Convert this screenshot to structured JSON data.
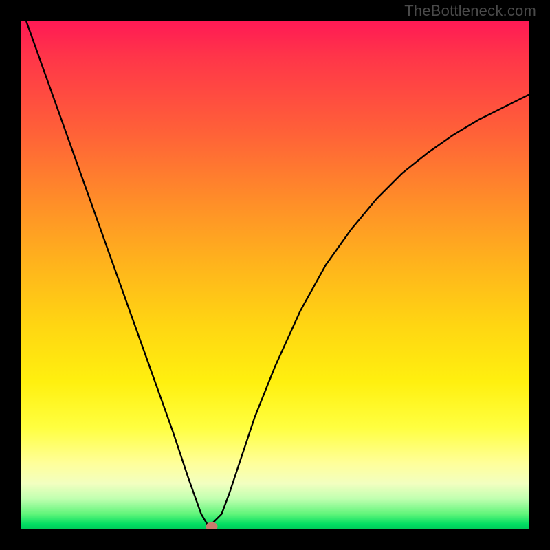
{
  "watermark": "TheBottleneck.com",
  "chart_data": {
    "type": "line",
    "title": "",
    "xlabel": "",
    "ylabel": "",
    "xlim": [
      0,
      1
    ],
    "ylim": [
      0,
      1
    ],
    "legend": false,
    "grid": false,
    "background_gradient": {
      "top_color": "#ff1955",
      "bottom_color": "#00c859",
      "description": "vertical gradient red→orange→yellow→green representing bottleneck severity (high at top, low at bottom)"
    },
    "marker": {
      "x": 0.375,
      "y": 0.005,
      "color": "#c97a6d"
    },
    "series": [
      {
        "name": "bottleneck-curve-left",
        "x": [
          0.0,
          0.05,
          0.1,
          0.15,
          0.2,
          0.25,
          0.3,
          0.33,
          0.355,
          0.37
        ],
        "values": [
          1.03,
          0.89,
          0.75,
          0.61,
          0.47,
          0.33,
          0.19,
          0.1,
          0.03,
          0.005
        ]
      },
      {
        "name": "bottleneck-curve-right",
        "x": [
          0.37,
          0.395,
          0.41,
          0.43,
          0.46,
          0.5,
          0.55,
          0.6,
          0.65,
          0.7,
          0.75,
          0.8,
          0.85,
          0.9,
          0.95,
          1.0
        ],
        "values": [
          0.005,
          0.03,
          0.07,
          0.13,
          0.22,
          0.32,
          0.43,
          0.52,
          0.59,
          0.65,
          0.7,
          0.74,
          0.775,
          0.805,
          0.83,
          0.855
        ]
      }
    ],
    "note": "x and values are normalized to plot-area width/height; values measure height from bottom (0=bottom, 1=top)."
  }
}
